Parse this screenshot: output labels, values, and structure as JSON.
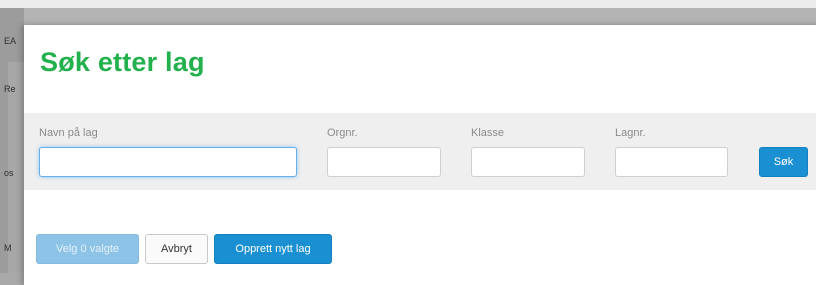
{
  "background": {
    "fragments": [
      "EA",
      "Re",
      "os",
      "M"
    ]
  },
  "modal": {
    "title": "Søk etter lag",
    "search": {
      "name_label": "Navn på lag",
      "name_value": "",
      "org_label": "Orgnr.",
      "org_value": "",
      "class_label": "Klasse",
      "class_value": "",
      "team_label": "Lagnr.",
      "team_value": "",
      "search_button": "Søk"
    },
    "footer": {
      "choose_button": "Velg 0 valgte",
      "cancel_button": "Avbryt",
      "create_button": "Opprett nytt lag"
    }
  },
  "colors": {
    "title_green": "#22b14c",
    "primary_blue": "#1a8fd2",
    "disabled_blue": "#8dc3e6",
    "panel_gray": "#efefef"
  }
}
